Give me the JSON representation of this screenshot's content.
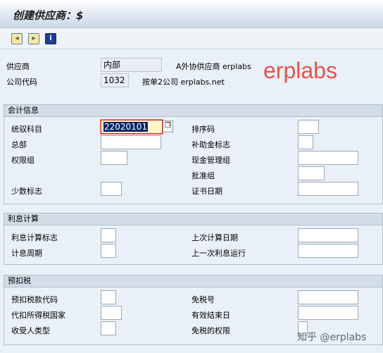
{
  "window": {
    "title": "创建供应商：$"
  },
  "toolbar": {
    "buttons": [
      {
        "name": "previous-icon",
        "glyph": "◂"
      },
      {
        "name": "next-icon",
        "glyph": "▸"
      },
      {
        "name": "info-icon",
        "glyph": "i"
      }
    ]
  },
  "header": {
    "vendor_label": "供应商",
    "vendor_value": "内部",
    "vendor_desc": "A外协供应商 erplabs",
    "company_label": "公司代码",
    "company_value": "1032",
    "company_desc": "按单2公司 erplabs.net"
  },
  "watermark": {
    "brand": "erplabs",
    "footer": "知乎 @erplabs"
  },
  "accounting": {
    "title": "会计信息",
    "recon_account_label": "统驭科目",
    "recon_account_value": "22020101",
    "sort_key_label": "排序码",
    "head_office_label": "总部",
    "subsidy_label": "补助金标志",
    "auth_group_label": "权限组",
    "cash_mgmt_label": "现金管理组",
    "release_group_label": "批准组",
    "minority_label": "少数标志",
    "cert_date_label": "证书日期"
  },
  "interest": {
    "title": "利息计算",
    "indicator_label": "利息计算标志",
    "last_calc_label": "上次计算日期",
    "cycle_label": "计息周期",
    "last_run_label": "上一次利息运行"
  },
  "withholding": {
    "title": "预扣税",
    "code_label": "预扣税款代码",
    "exemption_no_label": "免税号",
    "country_label": "代扣所得税国家",
    "valid_until_label": "有效结束日",
    "recipient_label": "收受人类型",
    "authority_label": "免税的权限"
  }
}
